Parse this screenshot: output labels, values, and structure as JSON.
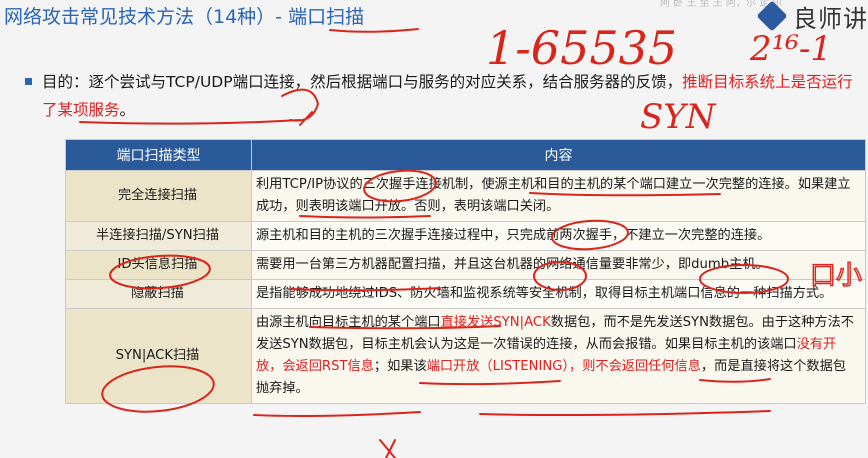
{
  "header": {
    "title_main": "网络攻击常见技术方法（14种）- ",
    "title_topic": "端口扫描",
    "faint_top_text": "阿 卧 王 至 王 阿，尔 定 尔",
    "logo_text": "良师讲"
  },
  "bullet": {
    "text_before": "目的：逐个尝试与TCP/UDP端口连接，然后根据端口与服务的对应关系，结合服务器的反馈，",
    "text_red": "推断目标系统上是否运行了某项服务",
    "text_after": "。"
  },
  "table": {
    "headers": [
      "端口扫描类型",
      "内容"
    ],
    "rows": [
      {
        "type": "完全连接扫描",
        "parts": [
          {
            "text": "利用TCP/IP协议的三次握手连接机制，使源主机和目的主机的某个端口建立一次完整的连接。如果建立成功，则表明该端口开放。否则，表明该端口关闭。",
            "red": false
          }
        ]
      },
      {
        "type": "半连接扫描/SYN扫描",
        "parts": [
          {
            "text": "源主机和目的主机的三次握手连接过程中，只完成前两次握手，不建立一次完整的连接。",
            "red": false
          }
        ]
      },
      {
        "type": "ID头信息扫描",
        "parts": [
          {
            "text": "需要用一台第三方机器配置扫描，并且这台机器的网络通信量要非常少，即dumb主机。",
            "red": false
          }
        ]
      },
      {
        "type": "隐蔽扫描",
        "parts": [
          {
            "text": "是指能够成功地绕过IDS、防火墙和监视系统等安全机制，取得目标主机端口信息的一种扫描方式。",
            "red": false
          }
        ]
      },
      {
        "type": "SYN|ACK扫描",
        "parts": [
          {
            "text": "由源主机向目标主机的某个端口",
            "red": false
          },
          {
            "text": "直接发送SYN|ACK",
            "red": true
          },
          {
            "text": "数据包，而不是先发送SYN数据包。由于这种方法不发送SYN数据包，目标主机会认为这是一次错误的连接，从而会报错。如果目标主机的该端口",
            "red": false
          },
          {
            "text": "没有开放，会返回RST信息",
            "red": true
          },
          {
            "text": "；如果该",
            "red": false
          },
          {
            "text": "端口开放（LISTENING），则不会返回任何信息",
            "red": true
          },
          {
            "text": "，而是直接将这个数据包抛弃掉。",
            "red": false
          }
        ]
      }
    ]
  },
  "handwriting": {
    "port_range": "1-65535",
    "power": "2¹⁶-1",
    "syn_note": "SYN",
    "side_note": "口小"
  },
  "colors": {
    "title_blue": "#2a64b8",
    "header_blue": "#2a5a9a",
    "highlight_red": "#e02020",
    "type_cell_bg": "#ece4c8",
    "ink_red": "#d8261c"
  }
}
